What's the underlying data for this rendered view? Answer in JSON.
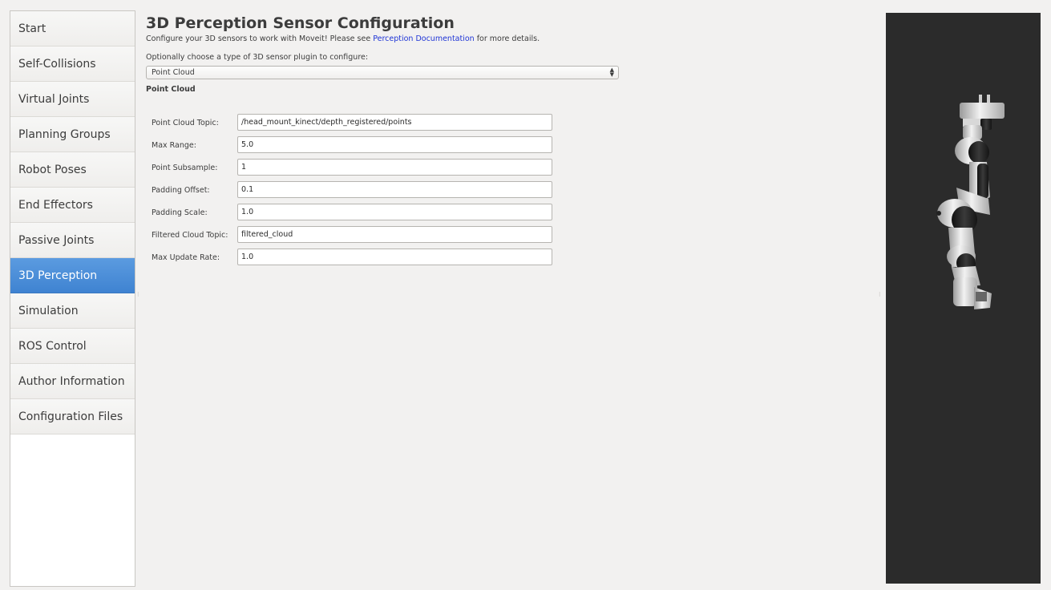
{
  "sidebar": {
    "items": [
      {
        "label": "Start"
      },
      {
        "label": "Self-Collisions"
      },
      {
        "label": "Virtual Joints"
      },
      {
        "label": "Planning Groups"
      },
      {
        "label": "Robot Poses"
      },
      {
        "label": "End Effectors"
      },
      {
        "label": "Passive Joints"
      },
      {
        "label": "3D Perception"
      },
      {
        "label": "Simulation"
      },
      {
        "label": "ROS Control"
      },
      {
        "label": "Author Information"
      },
      {
        "label": "Configuration Files"
      }
    ],
    "active": "3D Perception"
  },
  "header": {
    "title": "3D Perception Sensor Configuration",
    "subtitle_prefix": "Configure your 3D sensors to work with Moveit! Please see ",
    "subtitle_link": "Perception Documentation",
    "subtitle_suffix": " for more details."
  },
  "plugin": {
    "choose_label": "Optionally choose a type of 3D sensor plugin to configure:",
    "selected": "Point Cloud"
  },
  "section": {
    "title": "Point Cloud"
  },
  "form": {
    "fields": [
      {
        "label": "Point Cloud Topic:",
        "value": "/head_mount_kinect/depth_registered/points"
      },
      {
        "label": "Max Range:",
        "value": "5.0"
      },
      {
        "label": "Point Subsample:",
        "value": "1"
      },
      {
        "label": "Padding Offset:",
        "value": "0.1"
      },
      {
        "label": "Padding Scale:",
        "value": "1.0"
      },
      {
        "label": "Filtered Cloud Topic:",
        "value": "filtered_cloud"
      },
      {
        "label": "Max Update Rate:",
        "value": "1.0"
      }
    ]
  },
  "colors": {
    "accent": "#4a90d9",
    "link": "#1f35d6",
    "viewer_bg": "#2b2b2b"
  }
}
